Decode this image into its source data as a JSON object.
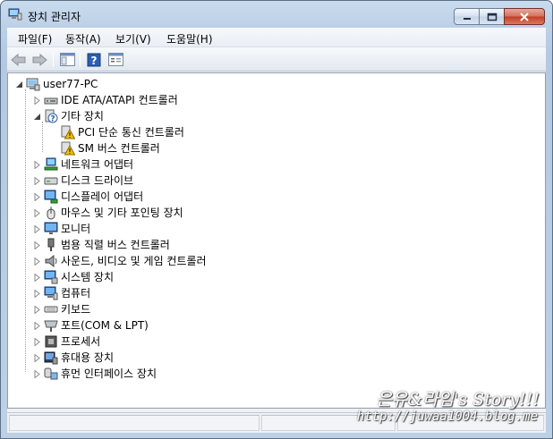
{
  "window": {
    "title": "장치 관리자"
  },
  "menu": [
    "파일(F)",
    "동작(A)",
    "보기(V)",
    "도움말(H)"
  ],
  "toolbar": {
    "buttons": [
      "back-arrow-icon",
      "forward-arrow-icon",
      "show-hide-tree-icon",
      "help-icon",
      "properties-icon"
    ]
  },
  "tree": {
    "root": "user77-PC",
    "items": [
      {
        "label": "IDE ATA/ATAPI 컨트롤러",
        "icon": "ide-controller-icon"
      },
      {
        "label": "기타 장치",
        "icon": "unknown-device-icon",
        "expanded": true,
        "children": [
          {
            "label": "PCI 단순 통신 컨트롤러",
            "icon": "warning-device-icon"
          },
          {
            "label": "SM 버스 컨트롤러",
            "icon": "warning-device-icon"
          }
        ]
      },
      {
        "label": "네트워크 어댑터",
        "icon": "network-adapter-icon"
      },
      {
        "label": "디스크 드라이브",
        "icon": "disk-drive-icon"
      },
      {
        "label": "디스플레이 어댑터",
        "icon": "display-adapter-icon"
      },
      {
        "label": "마우스 및 기타 포인팅 장치",
        "icon": "mouse-icon"
      },
      {
        "label": "모니터",
        "icon": "monitor-icon"
      },
      {
        "label": "범용 직렬 버스 컨트롤러",
        "icon": "usb-icon"
      },
      {
        "label": "사운드, 비디오 및 게임 컨트롤러",
        "icon": "speaker-icon"
      },
      {
        "label": "시스템 장치",
        "icon": "system-device-icon"
      },
      {
        "label": "컴퓨터",
        "icon": "computer-icon"
      },
      {
        "label": "키보드",
        "icon": "keyboard-icon"
      },
      {
        "label": "포트(COM & LPT)",
        "icon": "port-icon"
      },
      {
        "label": "프로세서",
        "icon": "processor-icon"
      },
      {
        "label": "휴대용 장치",
        "icon": "portable-device-icon"
      },
      {
        "label": "휴먼 인터페이스 장치",
        "icon": "hid-icon"
      }
    ]
  },
  "watermark": {
    "line1": "은유&라임's Story!!!",
    "line2": "http://juwaa1004.blog.me"
  },
  "colors": {
    "warning": "#f2c200",
    "selection": "#3399ff"
  }
}
